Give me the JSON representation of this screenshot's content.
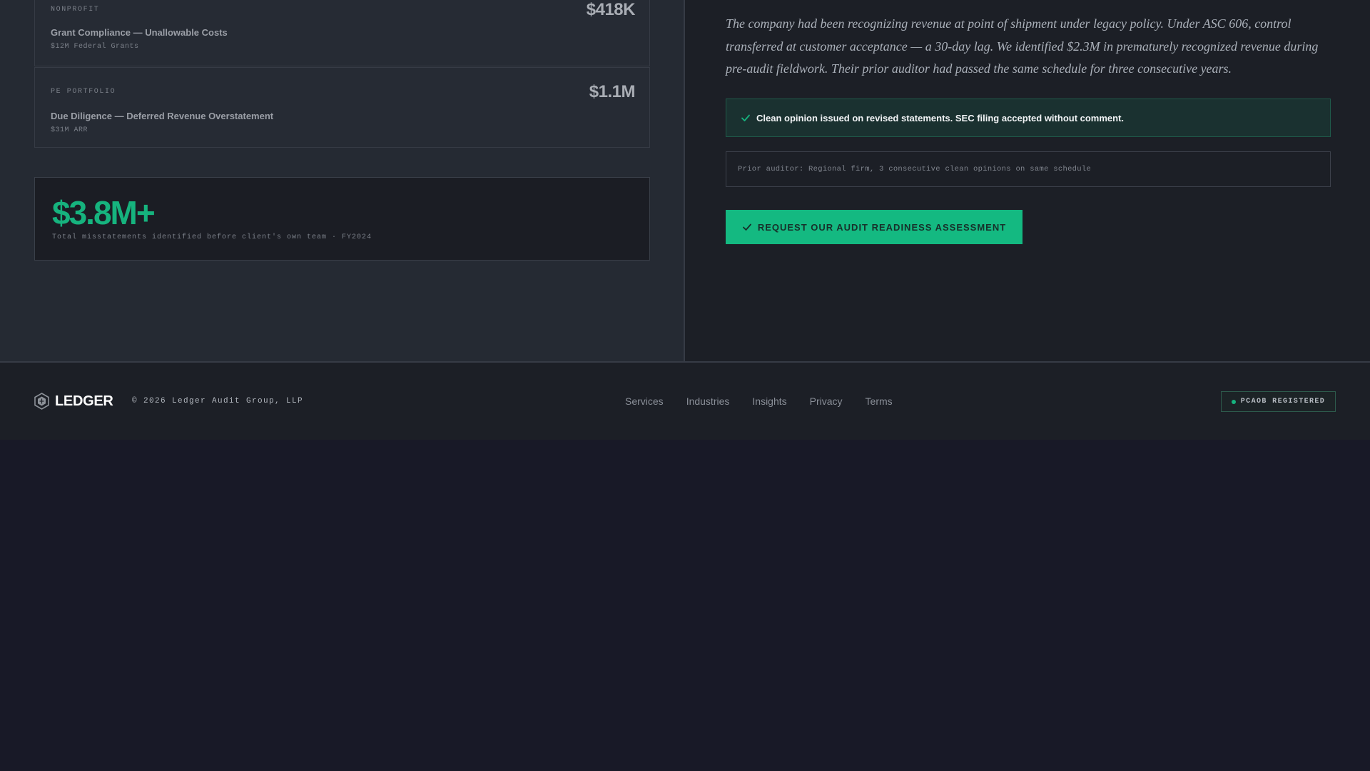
{
  "cases": [
    {
      "sector": "NONPROFIT",
      "amount": "$418K",
      "title": "Grant Compliance — Unallowable Costs",
      "meta": "$12M Federal Grants"
    },
    {
      "sector": "PE PORTFOLIO",
      "amount": "$1.1M",
      "title": "Due Diligence — Deferred Revenue Overstatement",
      "meta": "$31M ARR"
    }
  ],
  "total": {
    "value": "$3.8M+",
    "caption": "Total misstatements identified before client's own team · FY2024"
  },
  "case_study": {
    "narrative": "The company had been recognizing revenue at point of shipment under legacy policy. Under ASC 606, control transferred at customer acceptance — a 30-day lag. We identified $2.3M in prematurely recognized revenue during pre-audit fieldwork. Their prior auditor had passed the same schedule for three consecutive years.",
    "outcome": "Clean opinion issued on revised statements. SEC filing accepted without comment.",
    "prior_auditor": "Prior auditor: Regional firm, 3 consecutive clean opinions on same schedule",
    "cta_label": "REQUEST OUR AUDIT READINESS ASSESSMENT"
  },
  "footer": {
    "brand": "LEDGER",
    "copyright": "© 2026 Ledger Audit Group, LLP",
    "nav": [
      "Services",
      "Industries",
      "Insights",
      "Privacy",
      "Terms"
    ],
    "badge": "PCAOB REGISTERED"
  },
  "colors": {
    "accent": "#14b981",
    "accent_text": "#16b37e",
    "background": "#181927",
    "panel": "#252a33"
  },
  "icons": {
    "check": "check-icon",
    "logo": "hexagon-logo-icon",
    "status_dot": "status-dot-icon"
  }
}
